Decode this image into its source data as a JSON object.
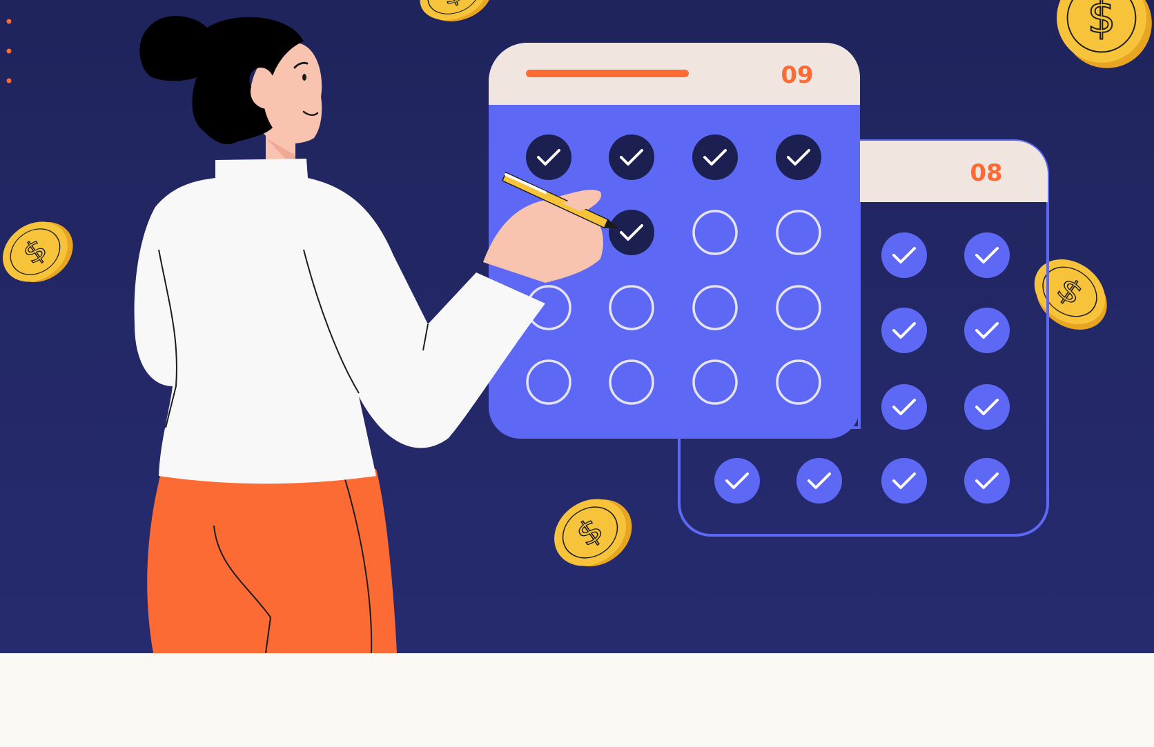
{
  "scene": {
    "colors": {
      "background_top": "#20245c",
      "background_bottom": "#262b70",
      "floor": "#fcf8f4",
      "calendar_blue": "#5d69f5",
      "calendar_header": "#f1e5df",
      "accent_orange": "#fd6b35",
      "check_dark": "#1c2050",
      "coin_gold": "#f6c33b",
      "shirt": "#f8f8f8",
      "pants": "#fd6b35",
      "skin": "#f8c4b0",
      "hair": "#000000"
    },
    "calendar_front": {
      "month_label": "09",
      "checked_count": 5,
      "total_days": 16
    },
    "calendar_back": {
      "month_label": "08",
      "checked_count": 16,
      "total_days": 16
    },
    "icons": [
      "dollar-coin-icon",
      "checkmark-icon",
      "pen-icon"
    ]
  }
}
